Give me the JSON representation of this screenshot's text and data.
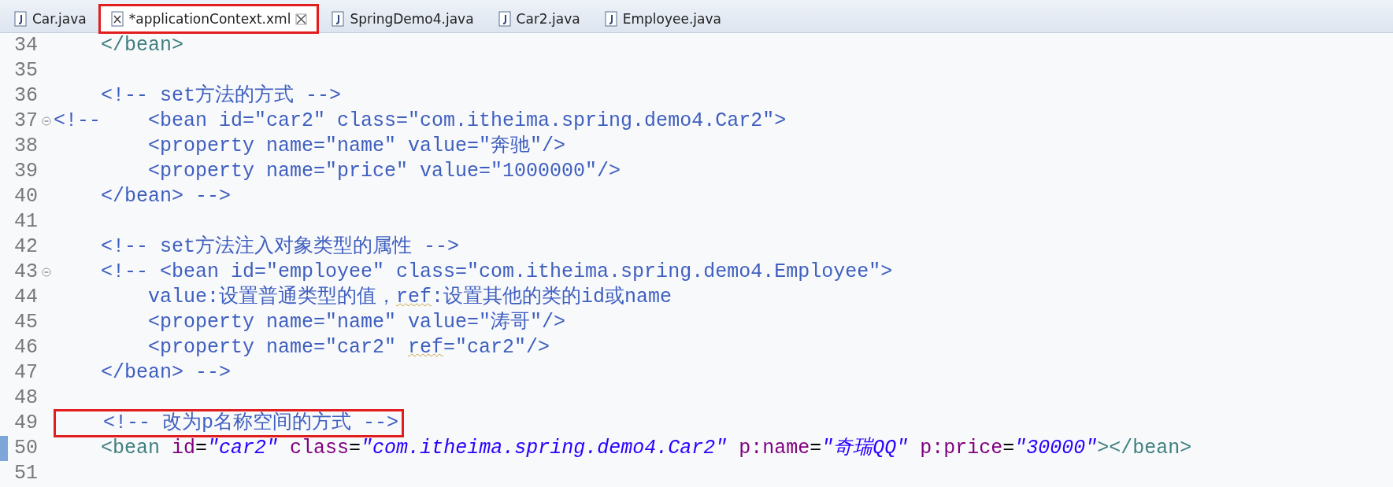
{
  "tabs": [
    {
      "label": "Car.java",
      "kind": "java",
      "selected": false,
      "highlighted": false
    },
    {
      "label": "*applicationContext.xml",
      "kind": "xml",
      "selected": true,
      "highlighted": true,
      "closable": true
    },
    {
      "label": "SpringDemo4.java",
      "kind": "java",
      "selected": false,
      "highlighted": false
    },
    {
      "label": "Car2.java",
      "kind": "java",
      "selected": false,
      "highlighted": false
    },
    {
      "label": "Employee.java",
      "kind": "java",
      "selected": false,
      "highlighted": false
    }
  ],
  "lines": [
    {
      "number": "34",
      "tokens": [
        {
          "kind": "tag",
          "text": "    </bean>"
        }
      ]
    },
    {
      "number": "35"
    },
    {
      "number": "36",
      "tokens": [
        {
          "kind": "comment",
          "text": "    <!-- set方法的方式 -->"
        }
      ]
    },
    {
      "number": "37",
      "fold_marker": true,
      "tokens": [
        {
          "kind": "comment",
          "text": "<!--    <bean id=\"car2\" class=\"com.itheima.spring.demo4.Car2\">"
        }
      ]
    },
    {
      "number": "38",
      "tokens": [
        {
          "kind": "comment",
          "text": "        <property name=\"name\" value=\"奔驰\"/>"
        }
      ]
    },
    {
      "number": "39",
      "tokens": [
        {
          "kind": "comment",
          "text": "        <property name=\"price\" value=\"1000000\"/>"
        }
      ]
    },
    {
      "number": "40",
      "tokens": [
        {
          "kind": "comment",
          "text": "    </bean> -->"
        }
      ]
    },
    {
      "number": "41"
    },
    {
      "number": "42",
      "tokens": [
        {
          "kind": "comment",
          "text": "    <!-- set方法注入对象类型的属性 -->"
        }
      ]
    },
    {
      "number": "43",
      "fold_marker": true,
      "tokens": [
        {
          "kind": "comment",
          "text": "    <!-- <bean id=\"employee\" class=\"com.itheima.spring.demo4.Employee\">"
        }
      ]
    },
    {
      "number": "44",
      "tokens": [
        {
          "kind": "comment",
          "text": "        value:设置普通类型的值，"
        },
        {
          "kind": "comment",
          "text": "ref",
          "spell_flag": true
        },
        {
          "kind": "comment",
          "text": ":设置其他的类的id或name"
        }
      ]
    },
    {
      "number": "45",
      "tokens": [
        {
          "kind": "comment",
          "text": "        <property name=\"name\" value=\"涛哥\"/>"
        }
      ]
    },
    {
      "number": "46",
      "tokens": [
        {
          "kind": "comment",
          "text": "        <property name=\"car2\" "
        },
        {
          "kind": "comment",
          "text": "ref",
          "spell_flag": true
        },
        {
          "kind": "comment",
          "text": "=\"car2\"/>"
        }
      ]
    },
    {
      "number": "47",
      "tokens": [
        {
          "kind": "comment",
          "text": "    </bean> -->"
        }
      ]
    },
    {
      "number": "48"
    },
    {
      "number": "49",
      "highlighted": true,
      "tokens": [
        {
          "kind": "comment",
          "text": "    <!-- 改为p名称空间的方式 -->"
        }
      ]
    },
    {
      "number": "50",
      "changed": true,
      "tokens": [
        {
          "kind": "tag",
          "text": "    <bean"
        },
        {
          "kind": "attr",
          "text": " id"
        },
        {
          "kind": "plain",
          "text": "="
        },
        {
          "kind": "value",
          "text": "\"car2\"",
          "italic": true
        },
        {
          "kind": "attr",
          "text": " class"
        },
        {
          "kind": "plain",
          "text": "="
        },
        {
          "kind": "value",
          "text": "\"com.itheima.spring.demo4.Car2\"",
          "italic": true
        },
        {
          "kind": "attr",
          "text": " p:name"
        },
        {
          "kind": "plain",
          "text": "="
        },
        {
          "kind": "value",
          "text": "\"奇瑞QQ\"",
          "italic": true
        },
        {
          "kind": "attr",
          "text": " p:price"
        },
        {
          "kind": "plain",
          "text": "="
        },
        {
          "kind": "value",
          "text": "\"30000\"",
          "italic": true
        },
        {
          "kind": "tag",
          "text": "></bean>"
        }
      ]
    },
    {
      "number": "51"
    }
  ]
}
